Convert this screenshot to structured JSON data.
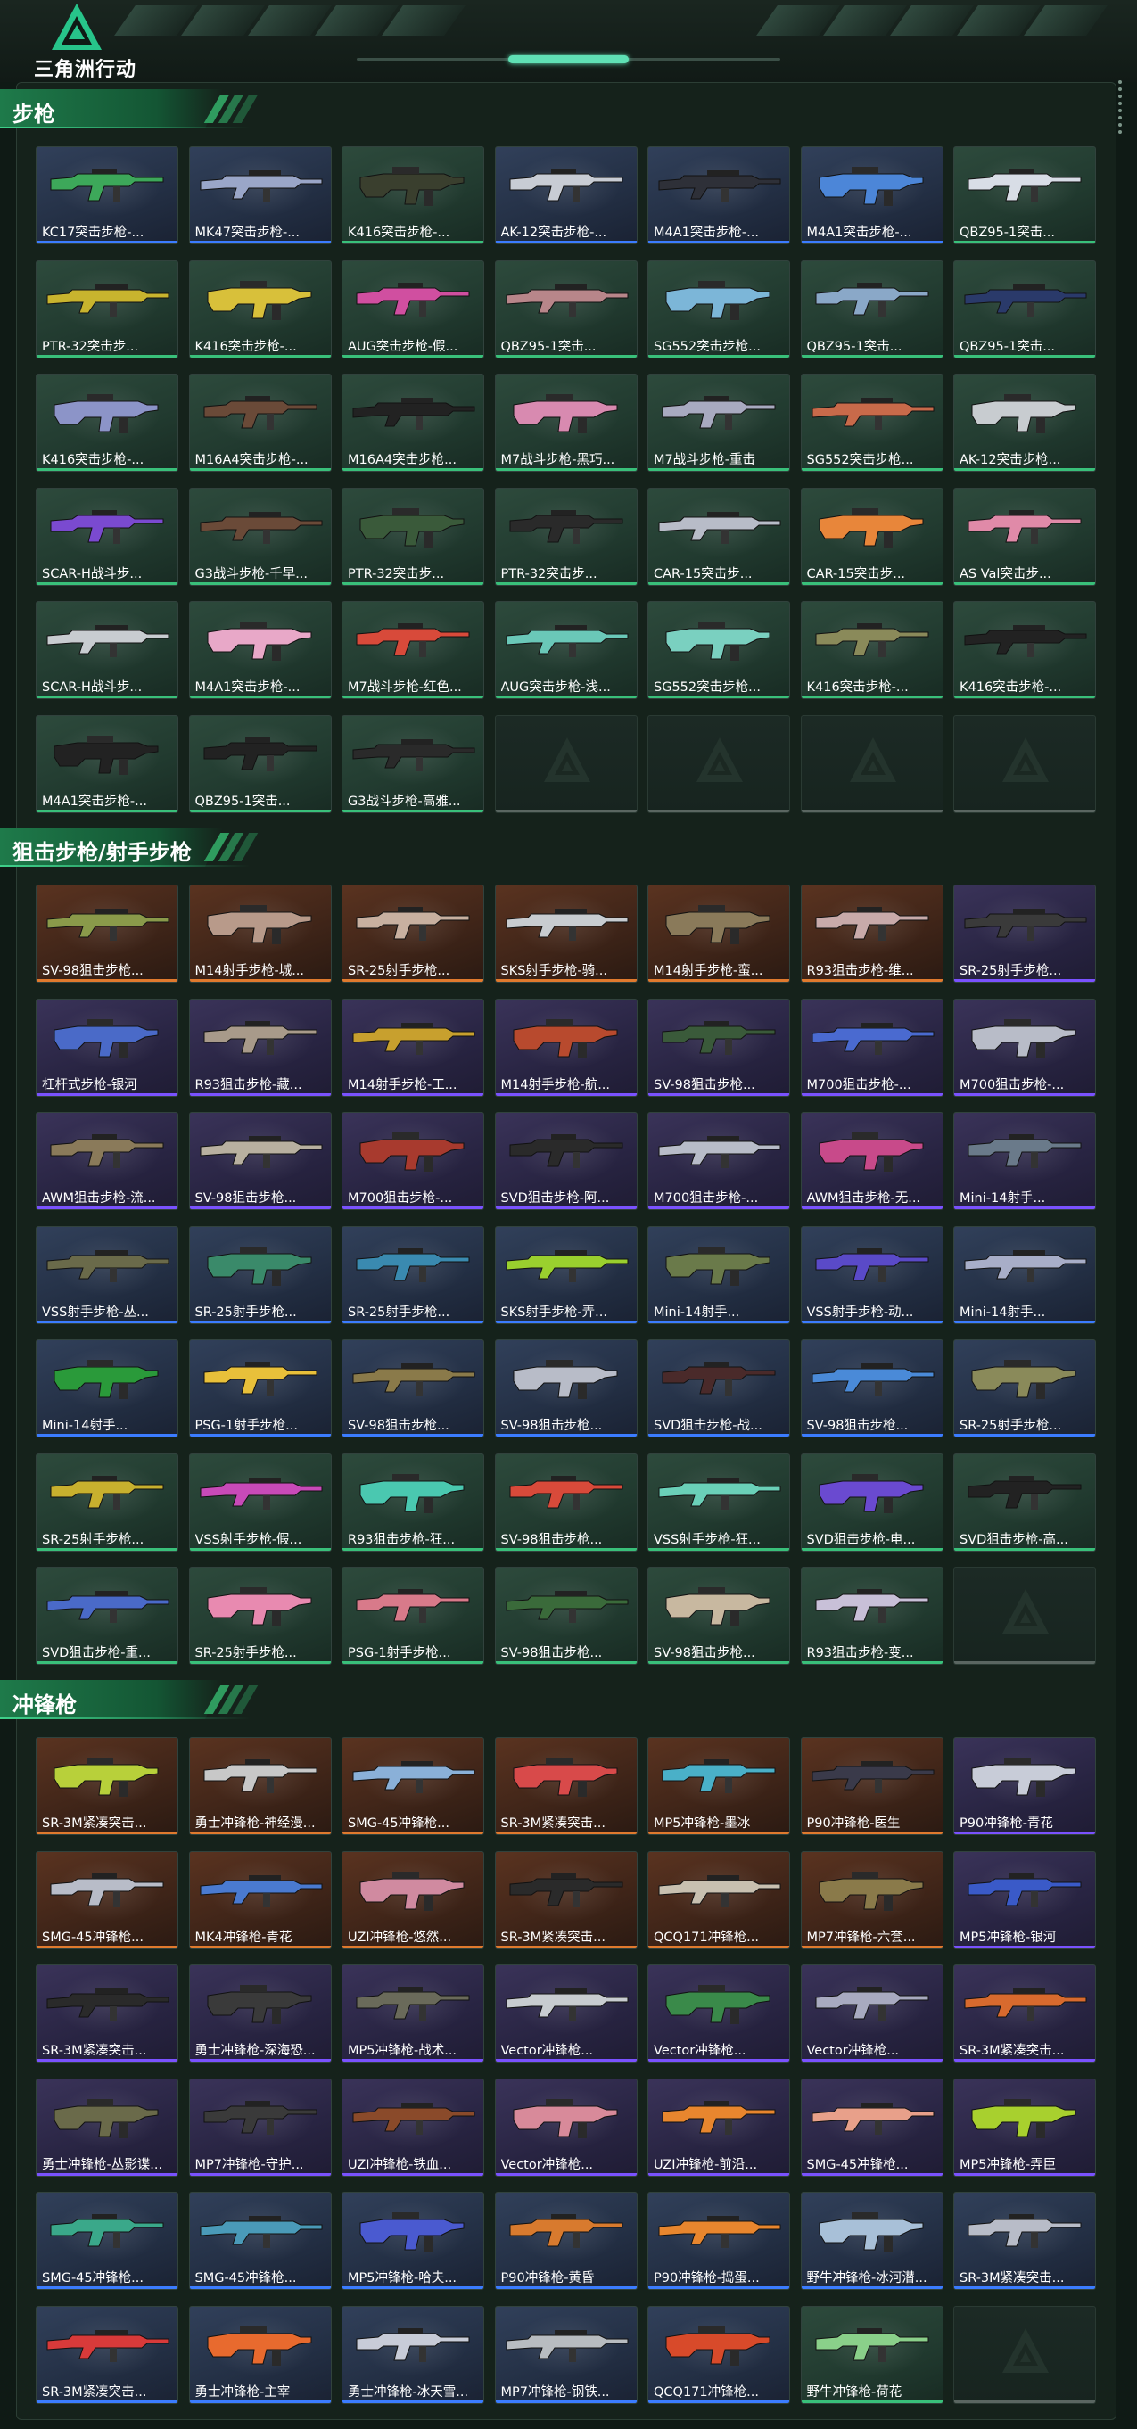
{
  "app": {
    "logo_text": "三角洲行动"
  },
  "icons": {
    "logo": "delta-triangle-logo-icon",
    "empty_slot": "delta-triangle-placeholder-icon"
  },
  "colors": {
    "accent": "#3fd08a",
    "purple": "#7a52ff",
    "orange": "#e07a2e",
    "green": "#39c07a",
    "blue": "#3b7cff"
  },
  "sections": [
    {
      "title": "步枪",
      "items": [
        {
          "name": "KC17突击步枪-...",
          "rarity": "blue",
          "tint": "#3da85a"
        },
        {
          "name": "MK47突击步枪-...",
          "rarity": "blue",
          "tint": "#9aa6c8"
        },
        {
          "name": "K416突击步枪-...",
          "rarity": "green",
          "tint": "#3a3f2e"
        },
        {
          "name": "AK-12突击步枪-...",
          "rarity": "blue",
          "tint": "#c8ccd4"
        },
        {
          "name": "M4A1突击步枪-...",
          "rarity": "blue",
          "tint": "#2e3038"
        },
        {
          "name": "M4A1突击步枪-...",
          "rarity": "blue",
          "tint": "#4c86d8"
        },
        {
          "name": "QBZ95-1突击...",
          "rarity": "green",
          "tint": "#d8dde6"
        },
        {
          "name": "PTR-32突击步...",
          "rarity": "green",
          "tint": "#c8b42e"
        },
        {
          "name": "K416突击步枪-...",
          "rarity": "green",
          "tint": "#d8c03a"
        },
        {
          "name": "AUG突击步枪-假...",
          "rarity": "green",
          "tint": "#d04fa0"
        },
        {
          "name": "QBZ95-1突击...",
          "rarity": "green",
          "tint": "#b8868a"
        },
        {
          "name": "SG552突击步枪...",
          "rarity": "green",
          "tint": "#7cb6d8"
        },
        {
          "name": "QBZ95-1突击...",
          "rarity": "green",
          "tint": "#8aa8c8"
        },
        {
          "name": "QBZ95-1突击...",
          "rarity": "green",
          "tint": "#2a3a6a"
        },
        {
          "name": "K416突击步枪-...",
          "rarity": "green",
          "tint": "#8c94c8"
        },
        {
          "name": "M16A4突击步枪-...",
          "rarity": "green",
          "tint": "#6a4a38"
        },
        {
          "name": "M16A4突击步枪...",
          "rarity": "green",
          "tint": "#222222"
        },
        {
          "name": "M7战斗步枪-黑巧...",
          "rarity": "green",
          "tint": "#d88ab0"
        },
        {
          "name": "M7战斗步枪-重击",
          "rarity": "green",
          "tint": "#a8aac0"
        },
        {
          "name": "SG552突击步枪...",
          "rarity": "green",
          "tint": "#c86a4a"
        },
        {
          "name": "AK-12突击步枪...",
          "rarity": "green",
          "tint": "#c8ccd0"
        },
        {
          "name": "SCAR-H战斗步...",
          "rarity": "green",
          "tint": "#7a4ad0"
        },
        {
          "name": "G3战斗步枪-千早...",
          "rarity": "green",
          "tint": "#6a4a38"
        },
        {
          "name": "PTR-32突击步...",
          "rarity": "green",
          "tint": "#3a5a3a"
        },
        {
          "name": "PTR-32突击步...",
          "rarity": "green",
          "tint": "#2a2a2a"
        },
        {
          "name": "CAR-15突击步...",
          "rarity": "green",
          "tint": "#b8bcc8"
        },
        {
          "name": "CAR-15突击步...",
          "rarity": "green",
          "tint": "#e8863a"
        },
        {
          "name": "AS Val突击步...",
          "rarity": "green",
          "tint": "#e08aa8"
        },
        {
          "name": "SCAR-H战斗步...",
          "rarity": "green",
          "tint": "#c8ccd0"
        },
        {
          "name": "M4A1突击步枪-...",
          "rarity": "green",
          "tint": "#e8a8c8"
        },
        {
          "name": "M7战斗步枪-红色...",
          "rarity": "green",
          "tint": "#d84a3a"
        },
        {
          "name": "AUG突击步枪-浅...",
          "rarity": "green",
          "tint": "#6ac8b8"
        },
        {
          "name": "SG552突击步枪...",
          "rarity": "green",
          "tint": "#7ad0c0"
        },
        {
          "name": "K416突击步枪-...",
          "rarity": "green",
          "tint": "#8a8a5a"
        },
        {
          "name": "K416突击步枪-...",
          "rarity": "green",
          "tint": "#222222"
        },
        {
          "name": "M4A1突击步枪-...",
          "rarity": "green",
          "tint": "#222222"
        },
        {
          "name": "QBZ95-1突击...",
          "rarity": "green",
          "tint": "#222222"
        },
        {
          "name": "G3战斗步枪-高雅...",
          "rarity": "green",
          "tint": "#2a2a2a"
        }
      ],
      "empty_slots": 4
    },
    {
      "title": "狙击步枪/射手步枪",
      "items": [
        {
          "name": "SV-98狙击步枪...",
          "rarity": "orange",
          "tint": "#8a9a4a"
        },
        {
          "name": "M14射手步枪-城...",
          "rarity": "orange",
          "tint": "#b89a8a"
        },
        {
          "name": "SR-25射手步枪...",
          "rarity": "orange",
          "tint": "#c8b0a0"
        },
        {
          "name": "SKS射手步枪-骑...",
          "rarity": "orange",
          "tint": "#c8ccd0"
        },
        {
          "name": "M14射手步枪-蛮...",
          "rarity": "orange",
          "tint": "#8a7a5a"
        },
        {
          "name": "R93狙击步枪-维...",
          "rarity": "orange",
          "tint": "#c8aaaa"
        },
        {
          "name": "SR-25射手步枪...",
          "rarity": "purple",
          "tint": "#3a3a3a"
        },
        {
          "name": "杠杆式步枪-银河",
          "rarity": "purple",
          "tint": "#4a6ac8"
        },
        {
          "name": "R93狙击步枪-藏...",
          "rarity": "purple",
          "tint": "#a89a8a"
        },
        {
          "name": "M14射手步枪-工...",
          "rarity": "purple",
          "tint": "#c8a02e"
        },
        {
          "name": "M14射手步枪-航...",
          "rarity": "purple",
          "tint": "#b84a2e"
        },
        {
          "name": "SV-98狙击步枪...",
          "rarity": "purple",
          "tint": "#3a5a3a"
        },
        {
          "name": "M700狙击步枪-...",
          "rarity": "purple",
          "tint": "#4a6ad0"
        },
        {
          "name": "M700狙击步枪-...",
          "rarity": "purple",
          "tint": "#b8bcc8"
        },
        {
          "name": "AWM狙击步枪-流...",
          "rarity": "purple",
          "tint": "#8a7a5a"
        },
        {
          "name": "SV-98狙击步枪...",
          "rarity": "purple",
          "tint": "#b8b0a0"
        },
        {
          "name": "M700狙击步枪-...",
          "rarity": "purple",
          "tint": "#a83a2e"
        },
        {
          "name": "SVD狙击步枪-阿...",
          "rarity": "purple",
          "tint": "#2a2a2a"
        },
        {
          "name": "M700狙击步枪-...",
          "rarity": "purple",
          "tint": "#b8bcc8"
        },
        {
          "name": "AWM狙击步枪-无...",
          "rarity": "purple",
          "tint": "#c84a8a"
        },
        {
          "name": "Mini-14射手...",
          "rarity": "purple",
          "tint": "#6a7a8a"
        },
        {
          "name": "VSS射手步枪-丛...",
          "rarity": "blue",
          "tint": "#6a6a4a"
        },
        {
          "name": "SR-25射手步枪...",
          "rarity": "blue",
          "tint": "#3a8a6a"
        },
        {
          "name": "SR-25射手步枪...",
          "rarity": "blue",
          "tint": "#3a8ab0"
        },
        {
          "name": "SKS射手步枪-弄...",
          "rarity": "blue",
          "tint": "#9ad02e"
        },
        {
          "name": "Mini-14射手...",
          "rarity": "blue",
          "tint": "#6a7a4a"
        },
        {
          "name": "VSS射手步枪-动...",
          "rarity": "blue",
          "tint": "#5a4ac8"
        },
        {
          "name": "Mini-14射手...",
          "rarity": "blue",
          "tint": "#a8aec8"
        },
        {
          "name": "Mini-14射手...",
          "rarity": "blue",
          "tint": "#2a9a3a"
        },
        {
          "name": "PSG-1射手步枪...",
          "rarity": "blue",
          "tint": "#e8c03a"
        },
        {
          "name": "SV-98狙击步枪...",
          "rarity": "blue",
          "tint": "#8a7a4a"
        },
        {
          "name": "SV-98狙击步枪...",
          "rarity": "blue",
          "tint": "#b8bcc8"
        },
        {
          "name": "SVD狙击步枪-战...",
          "rarity": "blue",
          "tint": "#4a2a2a"
        },
        {
          "name": "SV-98狙击步枪...",
          "rarity": "blue",
          "tint": "#4a8ad8"
        },
        {
          "name": "SR-25射手步枪...",
          "rarity": "blue",
          "tint": "#8a8a5a"
        },
        {
          "name": "SR-25射手步枪...",
          "rarity": "green",
          "tint": "#c8b02e"
        },
        {
          "name": "VSS射手步枪-假...",
          "rarity": "green",
          "tint": "#c84ab8"
        },
        {
          "name": "R93狙击步枪-狂...",
          "rarity": "green",
          "tint": "#4ac8b0"
        },
        {
          "name": "SV-98狙击步枪...",
          "rarity": "green",
          "tint": "#d84a3a"
        },
        {
          "name": "VSS射手步枪-狂...",
          "rarity": "green",
          "tint": "#6ad0b8"
        },
        {
          "name": "SVD狙击步枪-电...",
          "rarity": "green",
          "tint": "#6a4ad0"
        },
        {
          "name": "SVD狙击步枪-高...",
          "rarity": "green",
          "tint": "#222222"
        },
        {
          "name": "SVD狙击步枪-重...",
          "rarity": "green",
          "tint": "#4a6ac8"
        },
        {
          "name": "SR-25射手步枪...",
          "rarity": "green",
          "tint": "#e88ab0"
        },
        {
          "name": "PSG-1射手步枪...",
          "rarity": "green",
          "tint": "#d87a8a"
        },
        {
          "name": "SV-98狙击步枪...",
          "rarity": "green",
          "tint": "#3a6a3a"
        },
        {
          "name": "SV-98狙击步枪...",
          "rarity": "green",
          "tint": "#c8b8a0"
        },
        {
          "name": "R93狙击步枪-变...",
          "rarity": "green",
          "tint": "#c8c0d8"
        }
      ],
      "empty_slots": 1
    },
    {
      "title": "冲锋枪",
      "items": [
        {
          "name": "SR-3M紧凑突击...",
          "rarity": "orange",
          "tint": "#b8d03a"
        },
        {
          "name": "勇士冲锋枪-神经漫...",
          "rarity": "orange",
          "tint": "#c8c8c8"
        },
        {
          "name": "SMG-45冲锋枪...",
          "rarity": "orange",
          "tint": "#8ab0d8"
        },
        {
          "name": "SR-3M紧凑突击...",
          "rarity": "orange",
          "tint": "#d84a4a"
        },
        {
          "name": "MP5冲锋枪-墨冰",
          "rarity": "orange",
          "tint": "#4ab0c8"
        },
        {
          "name": "P90冲锋枪-医生",
          "rarity": "orange",
          "tint": "#3a3a4a"
        },
        {
          "name": "P90冲锋枪-青花",
          "rarity": "purple",
          "tint": "#c8ccd8"
        },
        {
          "name": "SMG-45冲锋枪...",
          "rarity": "orange",
          "tint": "#b8bcc8"
        },
        {
          "name": "MK4冲锋枪-青花",
          "rarity": "orange",
          "tint": "#4a7ad0"
        },
        {
          "name": "UZI冲锋枪-悠然...",
          "rarity": "orange",
          "tint": "#d08aa0"
        },
        {
          "name": "SR-3M紧凑突击...",
          "rarity": "orange",
          "tint": "#2a2a2a"
        },
        {
          "name": "QCQ171冲锋枪...",
          "rarity": "orange",
          "tint": "#c8c0b0"
        },
        {
          "name": "MP7冲锋枪-六套...",
          "rarity": "orange",
          "tint": "#8a7a4a"
        },
        {
          "name": "MP5冲锋枪-银河",
          "rarity": "purple",
          "tint": "#3a5ac8"
        },
        {
          "name": "SR-3M紧凑突击...",
          "rarity": "purple",
          "tint": "#2a2a2a"
        },
        {
          "name": "勇士冲锋枪-深海恐...",
          "rarity": "purple",
          "tint": "#3a3a3a"
        },
        {
          "name": "MP5冲锋枪-战术...",
          "rarity": "purple",
          "tint": "#6a6a5a"
        },
        {
          "name": "Vector冲锋枪...",
          "rarity": "purple",
          "tint": "#c8ccd0"
        },
        {
          "name": "Vector冲锋枪...",
          "rarity": "purple",
          "tint": "#3a8a4a"
        },
        {
          "name": "Vector冲锋枪...",
          "rarity": "purple",
          "tint": "#a8aac0"
        },
        {
          "name": "SR-3M紧凑突击...",
          "rarity": "purple",
          "tint": "#d86a2e"
        },
        {
          "name": "勇士冲锋枪-丛影谍...",
          "rarity": "purple",
          "tint": "#6a6a4a"
        },
        {
          "name": "MP7冲锋枪-守护...",
          "rarity": "purple",
          "tint": "#3a3a3a"
        },
        {
          "name": "UZI冲锋枪-铁血...",
          "rarity": "purple",
          "tint": "#8a4a2a"
        },
        {
          "name": "Vector冲锋枪...",
          "rarity": "purple",
          "tint": "#d88a9a"
        },
        {
          "name": "UZI冲锋枪-前沿...",
          "rarity": "purple",
          "tint": "#e8862e"
        },
        {
          "name": "SMG-45冲锋枪...",
          "rarity": "purple",
          "tint": "#e8a08a"
        },
        {
          "name": "MP5冲锋枪-弄臣",
          "rarity": "purple",
          "tint": "#a8d02e"
        },
        {
          "name": "SMG-45冲锋枪...",
          "rarity": "blue",
          "tint": "#3aa88a"
        },
        {
          "name": "SMG-45冲锋枪...",
          "rarity": "blue",
          "tint": "#4a9ab8"
        },
        {
          "name": "MP5冲锋枪-哈夫...",
          "rarity": "blue",
          "tint": "#4a5ad0"
        },
        {
          "name": "P90冲锋枪-黄昏",
          "rarity": "blue",
          "tint": "#d87a2e"
        },
        {
          "name": "P90冲锋枪-捣蛋...",
          "rarity": "blue",
          "tint": "#e8862e"
        },
        {
          "name": "野牛冲锋枪-冰河潜...",
          "rarity": "blue",
          "tint": "#a8c0d8"
        },
        {
          "name": "SR-3M紧凑突击...",
          "rarity": "blue",
          "tint": "#b8bcc8"
        },
        {
          "name": "SR-3M紧凑突击...",
          "rarity": "blue",
          "tint": "#d83a3a"
        },
        {
          "name": "勇士冲锋枪-主宰",
          "rarity": "blue",
          "tint": "#e86a2e"
        },
        {
          "name": "勇士冲锋枪-冰天雪...",
          "rarity": "blue",
          "tint": "#c8ccd8"
        },
        {
          "name": "MP7冲锋枪-钢铁...",
          "rarity": "blue",
          "tint": "#b8bcc0"
        },
        {
          "name": "QCQ171冲锋枪...",
          "rarity": "blue",
          "tint": "#d84a2a"
        },
        {
          "name": "野牛冲锋枪-荷花",
          "rarity": "green",
          "tint": "#8ad08a"
        }
      ],
      "empty_slots": 1
    }
  ]
}
